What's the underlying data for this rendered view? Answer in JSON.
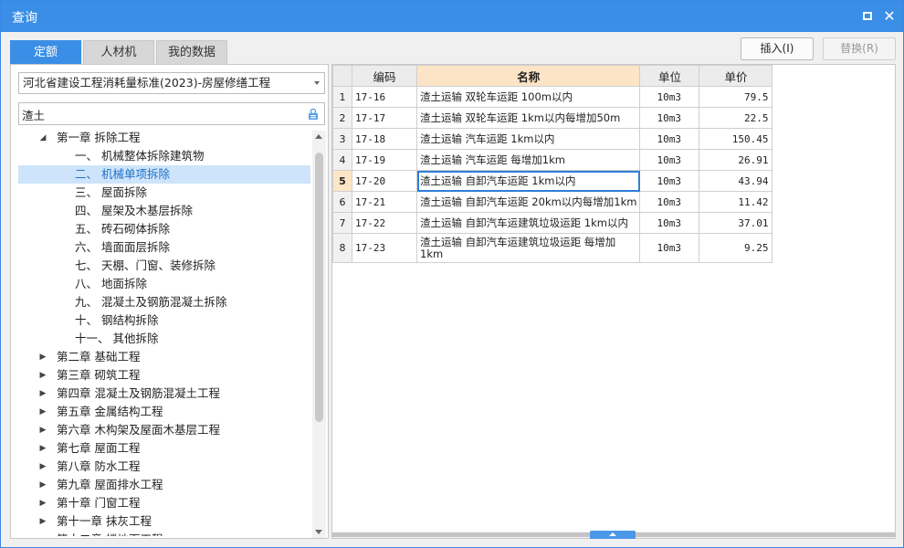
{
  "window": {
    "title": "查询"
  },
  "tabs": [
    {
      "label": "定额",
      "active": true
    },
    {
      "label": "人材机",
      "active": false
    },
    {
      "label": "我的数据",
      "active": false
    }
  ],
  "actions": {
    "insert": "插入(I)",
    "replace": "替换(R)"
  },
  "library": {
    "selected": "河北省建设工程消耗量标准(2023)-房屋修缮工程"
  },
  "search": {
    "value": "渣土",
    "placeholder": ""
  },
  "tree": [
    {
      "label": "第一章 拆除工程",
      "level": 1,
      "expanded": true
    },
    {
      "label": "一、 机械整体拆除建筑物",
      "level": 2
    },
    {
      "label": "二、 机械单项拆除",
      "level": 2,
      "selected": true
    },
    {
      "label": "三、 屋面拆除",
      "level": 2
    },
    {
      "label": "四、 屋架及木基层拆除",
      "level": 2
    },
    {
      "label": "五、 砖石砌体拆除",
      "level": 2
    },
    {
      "label": "六、 墙面面层拆除",
      "level": 2
    },
    {
      "label": "七、 天棚、门窗、装修拆除",
      "level": 2
    },
    {
      "label": "八、 地面拆除",
      "level": 2
    },
    {
      "label": "九、 混凝土及钢筋混凝土拆除",
      "level": 2
    },
    {
      "label": "十、 钢结构拆除",
      "level": 2
    },
    {
      "label": "十一、 其他拆除",
      "level": 2
    },
    {
      "label": "第二章 基础工程",
      "level": 1
    },
    {
      "label": "第三章 砌筑工程",
      "level": 1
    },
    {
      "label": "第四章 混凝土及钢筋混凝土工程",
      "level": 1
    },
    {
      "label": "第五章 金属结构工程",
      "level": 1
    },
    {
      "label": "第六章 木构架及屋面木基层工程",
      "level": 1
    },
    {
      "label": "第七章 屋面工程",
      "level": 1
    },
    {
      "label": "第八章 防水工程",
      "level": 1
    },
    {
      "label": "第九章 屋面排水工程",
      "level": 1
    },
    {
      "label": "第十章 门窗工程",
      "level": 1
    },
    {
      "label": "第十一章 抹灰工程",
      "level": 1
    },
    {
      "label": "第十二章 楼地面工程",
      "level": 1
    }
  ],
  "table": {
    "headers": {
      "code": "编码",
      "name": "名称",
      "unit": "单位",
      "price": "单价"
    },
    "current_row": 5,
    "rows": [
      {
        "no": "1",
        "code": "17-16",
        "name": "渣土运输 双轮车运距 100m以内",
        "unit": "10m3",
        "price": "79.5"
      },
      {
        "no": "2",
        "code": "17-17",
        "name": "渣土运输 双轮车运距 1km以内每增加50m",
        "unit": "10m3",
        "price": "22.5"
      },
      {
        "no": "3",
        "code": "17-18",
        "name": "渣土运输 汽车运距 1km以内",
        "unit": "10m3",
        "price": "150.45"
      },
      {
        "no": "4",
        "code": "17-19",
        "name": "渣土运输 汽车运距 每增加1km",
        "unit": "10m3",
        "price": "26.91"
      },
      {
        "no": "5",
        "code": "17-20",
        "name": "渣土运输 自卸汽车运距 1km以内",
        "unit": "10m3",
        "price": "43.94"
      },
      {
        "no": "6",
        "code": "17-21",
        "name": "渣土运输 自卸汽车运距 20km以内每增加1km",
        "unit": "10m3",
        "price": "11.42"
      },
      {
        "no": "7",
        "code": "17-22",
        "name": "渣土运输 自卸汽车运建筑垃圾运距 1km以内",
        "unit": "10m3",
        "price": "37.01"
      },
      {
        "no": "8",
        "code": "17-23",
        "name": "渣土运输 自卸汽车运建筑垃圾运距 每增加1km",
        "unit": "10m3",
        "price": "9.25"
      }
    ]
  },
  "colors": {
    "accent": "#3a8ee6",
    "selection": "#cde4fb",
    "header_highlight": "#fce4c6"
  }
}
